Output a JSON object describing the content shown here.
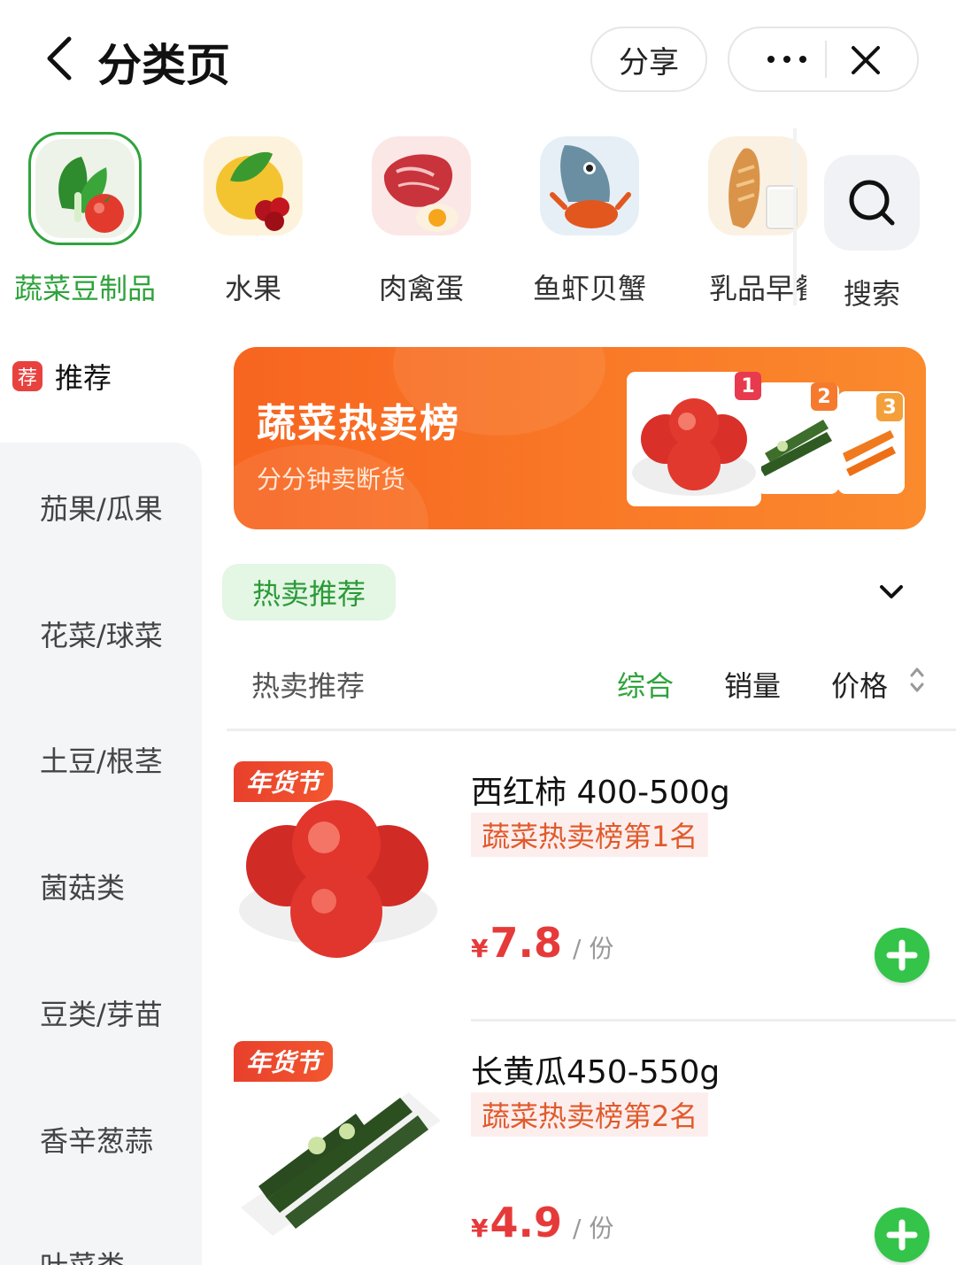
{
  "header": {
    "title": "分类页",
    "share_label": "分享"
  },
  "categories": [
    {
      "label": "蔬菜豆制品",
      "icon": "vegetable-icon",
      "active": true
    },
    {
      "label": "水果",
      "icon": "fruit-icon",
      "active": false
    },
    {
      "label": "肉禽蛋",
      "icon": "meat-icon",
      "active": false
    },
    {
      "label": "鱼虾贝蟹",
      "icon": "seafood-icon",
      "active": false
    },
    {
      "label": "乳品早餐",
      "icon": "dairy-icon",
      "active": false
    },
    {
      "label": "搜索",
      "icon": "search-icon",
      "active": false
    }
  ],
  "sidebar": {
    "rec_tag": "荐",
    "rec_label": "推荐",
    "items": [
      "茄果/瓜果",
      "花菜/球菜",
      "土豆/根茎",
      "菌菇类",
      "豆类/芽苗",
      "香辛葱蒜",
      "叶菜类"
    ]
  },
  "banner": {
    "title": "蔬菜热卖榜",
    "subtitle": "分分钟卖断货",
    "ranks": [
      "1",
      "2",
      "3"
    ]
  },
  "filter": {
    "chip": "热卖推荐",
    "section_label": "热卖推荐",
    "sort_options": [
      "综合",
      "销量",
      "价格"
    ],
    "active_sort": "综合"
  },
  "products": [
    {
      "tag": "年货节",
      "name": "西红柿 400-500g",
      "rank": "蔬菜热卖榜第1名",
      "currency": "¥",
      "price": "7.8",
      "unit": "/ 份"
    },
    {
      "tag": "年货节",
      "name": "长黄瓜450-550g",
      "rank": "蔬菜热卖榜第2名",
      "currency": "¥",
      "price": "4.9",
      "unit": "/ 份"
    }
  ],
  "colors": {
    "accent_green": "#2fa33c",
    "price_red": "#e63a3a",
    "banner_orange": "#f76520"
  }
}
